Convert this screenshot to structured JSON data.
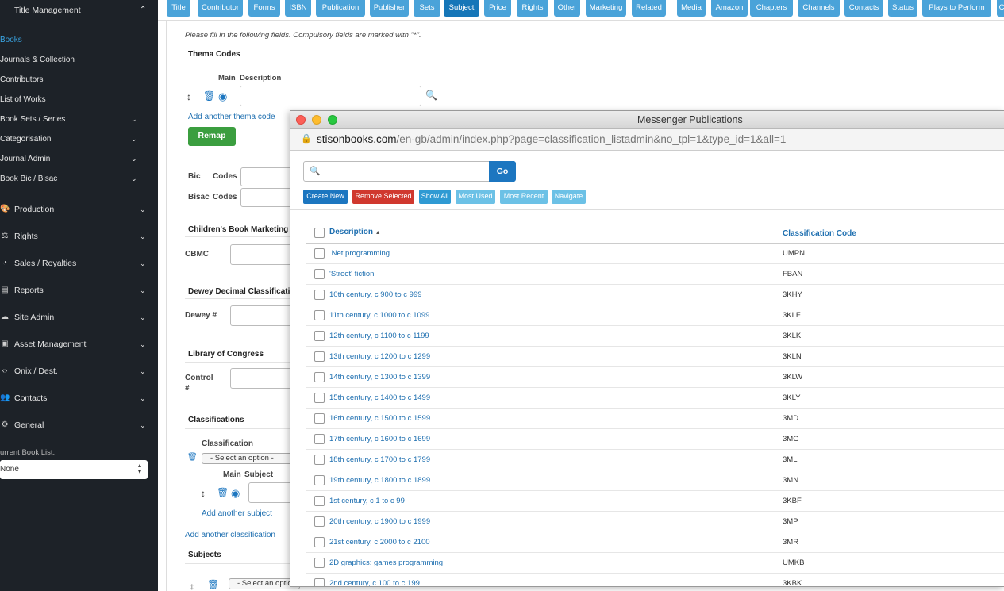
{
  "sidebar": {
    "header": "Title Management",
    "subitems": [
      {
        "label": "Books",
        "active": true,
        "chevron": false
      },
      {
        "label": "Journals & Collection",
        "chevron": false
      },
      {
        "label": "Contributors",
        "chevron": false
      },
      {
        "label": "List of Works",
        "chevron": false
      },
      {
        "label": "Book Sets / Series",
        "chevron": true
      },
      {
        "label": "Categorisation",
        "chevron": true
      },
      {
        "label": "Journal Admin",
        "chevron": true
      },
      {
        "label": "Book Bic / Bisac",
        "chevron": true
      }
    ],
    "main_items": [
      {
        "label": "Production",
        "icon": "production-icon"
      },
      {
        "label": "Rights",
        "icon": "rights-icon"
      },
      {
        "label": "Sales / Royalties",
        "icon": "sales-icon"
      },
      {
        "label": "Reports",
        "icon": "reports-icon"
      },
      {
        "label": "Site Admin",
        "icon": "cloud-icon"
      },
      {
        "label": "Asset Management",
        "icon": "image-icon"
      },
      {
        "label": "Onix / Dest.",
        "icon": "code-icon"
      },
      {
        "label": "Contacts",
        "icon": "users-icon"
      },
      {
        "label": "General",
        "icon": "cogs-icon"
      }
    ],
    "current_book_list_label": "urrent Book List:",
    "current_book_list_value": "None"
  },
  "tabs": [
    {
      "label": "Title"
    },
    {
      "label": "Contributor"
    },
    {
      "label": "Forms"
    },
    {
      "label": "ISBN"
    },
    {
      "label": "Publication"
    },
    {
      "label": "Publisher"
    },
    {
      "label": "Sets"
    },
    {
      "label": "Subject",
      "active": true
    },
    {
      "label": "Price"
    },
    {
      "label": "Rights"
    },
    {
      "label": "Other"
    },
    {
      "label": "Marketing"
    },
    {
      "label": "Related"
    },
    {
      "label": "Media"
    },
    {
      "label": "Amazon"
    },
    {
      "label": "Chapters"
    },
    {
      "label": "Channels"
    },
    {
      "label": "Contacts"
    },
    {
      "label": "Status"
    },
    {
      "label": "Plays to Perform"
    },
    {
      "label": "C"
    }
  ],
  "form": {
    "intro": "Please fill in the following fields. Compulsory fields are marked with \"*\".",
    "thema_title": "Thema Codes",
    "main_label": "Main",
    "description_label": "Description",
    "add_thema": "Add another thema code",
    "remap": "Remap",
    "bic_label": "Bic",
    "codes_label": "Codes",
    "bisac_label": "Bisac",
    "childrens_title": "Children's Book Marketing C",
    "cbmc_label": "CBMC",
    "dewey_title": "Dewey Decimal Classificatio",
    "dewey_label": "Dewey #",
    "loc_title": "Library of Congress",
    "control_label": "Control",
    "hash_label": "#",
    "classifications_title": "Classifications",
    "classification_label": "Classification",
    "select_option": "- Select an option -",
    "subject_label": "Subject",
    "add_subject": "Add another subject",
    "add_classification": "Add another classification",
    "subjects_title": "Subjects",
    "select_option_trunc": "- Select an optio"
  },
  "popup": {
    "window_title": "Messenger Publications",
    "url_host": "stisonbooks.com",
    "url_path": "/en-gb/admin/index.php?page=classification_listadmin&no_tpl=1&type_id=1&all=1",
    "search_placeholder": "",
    "go": "Go",
    "buttons": {
      "create": "Create New",
      "remove": "Remove Selected",
      "show_all": "Show All",
      "most_used": "Most Used",
      "most_recent": "Most Recent",
      "navigate": "Navigate"
    },
    "col_description": "Description",
    "sort_icon": "▲",
    "col_code": "Classification Code",
    "rows": [
      {
        "desc": ".Net programming",
        "code": "UMPN"
      },
      {
        "desc": "'Street' fiction",
        "code": "FBAN"
      },
      {
        "desc": "10th century, c 900 to c 999",
        "code": "3KHY"
      },
      {
        "desc": "11th century, c 1000 to c 1099",
        "code": "3KLF"
      },
      {
        "desc": "12th century, c 1100 to c 1199",
        "code": "3KLK"
      },
      {
        "desc": "13th century, c 1200 to c 1299",
        "code": "3KLN"
      },
      {
        "desc": "14th century, c 1300 to c 1399",
        "code": "3KLW"
      },
      {
        "desc": "15th century, c 1400 to c 1499",
        "code": "3KLY"
      },
      {
        "desc": "16th century, c 1500 to c 1599",
        "code": "3MD"
      },
      {
        "desc": "17th century, c 1600 to c 1699",
        "code": "3MG"
      },
      {
        "desc": "18th century, c 1700 to c 1799",
        "code": "3ML"
      },
      {
        "desc": "19th century, c 1800 to c 1899",
        "code": "3MN"
      },
      {
        "desc": "1st century, c 1 to c 99",
        "code": "3KBF"
      },
      {
        "desc": "20th century, c 1900 to c 1999",
        "code": "3MP"
      },
      {
        "desc": "21st century, c 2000 to c 2100",
        "code": "3MR"
      },
      {
        "desc": "2D graphics: games programming",
        "code": "UMKB"
      },
      {
        "desc": "2nd century, c 100 to c 199",
        "code": "3KBK"
      }
    ]
  }
}
